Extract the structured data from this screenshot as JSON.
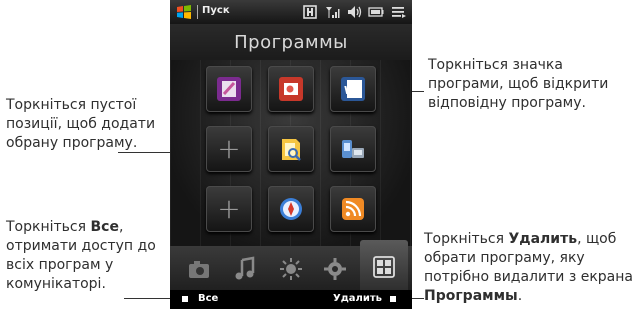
{
  "status_bar": {
    "start_label": "Пуск",
    "icons": [
      "windows-flag-icon",
      "network-icon",
      "signal-icon",
      "volume-icon",
      "battery-icon",
      "menu-icon"
    ]
  },
  "screen": {
    "title": "Программы",
    "rows": [
      [
        "onenote-icon",
        "powerpoint-icon",
        "word-icon"
      ],
      [
        "add-slot",
        "file-explorer-icon",
        "device-sync-icon"
      ],
      [
        "add-slot",
        "compass-icon",
        "rss-icon"
      ]
    ],
    "plus_symbol": "+"
  },
  "bottom_tabs": [
    "camera-icon",
    "music-icon",
    "weather-icon",
    "settings-icon",
    "programs-icon"
  ],
  "soft_keys": {
    "left": "Все",
    "right": "Удалить"
  },
  "callouts": {
    "top_left": "Торкніться пустої позиції, щоб додати обрану програму.",
    "bottom_left_prefix": "Торкніться ",
    "bottom_left_bold": "Все",
    "bottom_left_suffix": ", отримати доступ до всіх програм у комунікаторі.",
    "top_right": "Торкніться значка програми, щоб відкрити відповідну програму.",
    "bottom_right_prefix": "Торкніться ",
    "bottom_right_bold": "Удалить",
    "bottom_right_middle": ", щоб обрати програму, яку потрібно видалити з екрана ",
    "bottom_right_bold2": "Программы",
    "bottom_right_suffix": "."
  }
}
